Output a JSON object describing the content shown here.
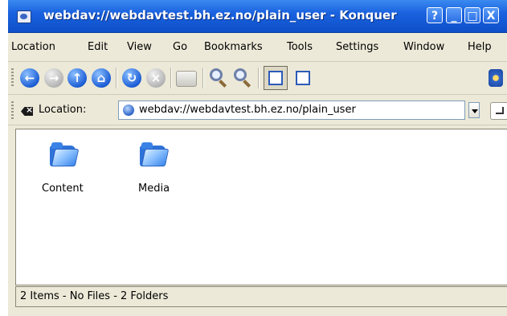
{
  "window": {
    "title": "webdav://webdavtest.bh.ez.no/plain_user - Konquer",
    "buttons": {
      "help": "?",
      "minimize": "_",
      "maximize": "□",
      "close": "X"
    }
  },
  "menubar": {
    "items": [
      "Location",
      "Edit",
      "View",
      "Go",
      "Bookmarks",
      "Tools",
      "Settings",
      "Window",
      "Help"
    ]
  },
  "toolbar": {
    "icons": [
      "back-icon",
      "forward-icon",
      "up-icon",
      "home-icon",
      "reload-icon",
      "stop-icon",
      "print-icon",
      "zoom-in-icon",
      "zoom-out-icon",
      "icon-view-icon",
      "tree-view-icon",
      "konqueror-gear-icon"
    ]
  },
  "location_bar": {
    "label": "Location:",
    "value": "webdav://webdavtest.bh.ez.no/plain_user"
  },
  "files": [
    {
      "name": "Content",
      "icon": "folder-icon"
    },
    {
      "name": "Media",
      "icon": "folder-icon"
    }
  ],
  "status": {
    "text": "2 Items - No Files - 2 Folders"
  },
  "colors": {
    "titlebar": "#1a62e0",
    "chrome": "#ece9d8",
    "folder": "#3a86ea"
  }
}
